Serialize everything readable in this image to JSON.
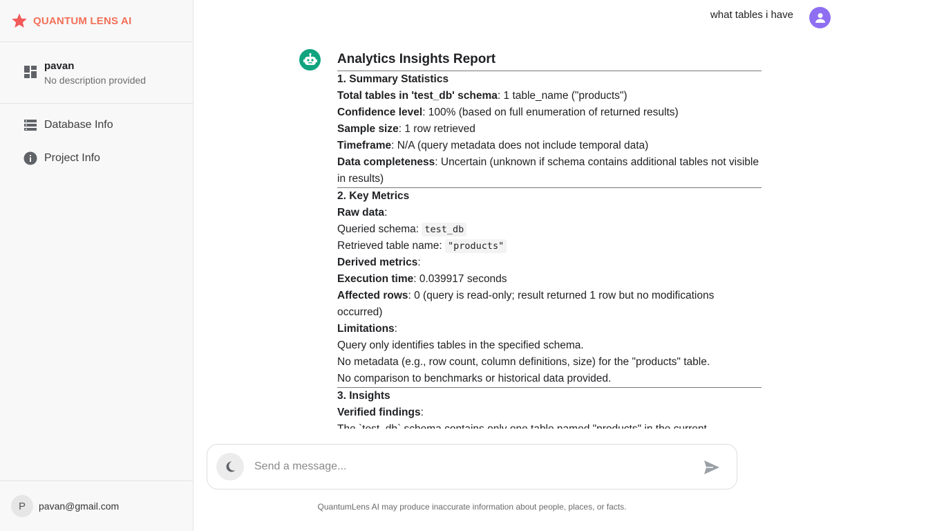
{
  "brand": {
    "name": "QUANTUM LENS AI",
    "color": "#f27058"
  },
  "project": {
    "name": "pavan",
    "description": "No description provided"
  },
  "nav": [
    {
      "label": "Database Info",
      "icon": "database-icon"
    },
    {
      "label": "Project Info",
      "icon": "info-icon"
    }
  ],
  "user": {
    "initial": "P",
    "email": "pavan@gmail.com"
  },
  "chat": {
    "user_message": "what tables i have",
    "report": {
      "title": "Analytics Insights Report",
      "s1": {
        "heading": "1. Summary Statistics",
        "items": [
          {
            "bold": "Total tables in 'test_db' schema",
            "text": ": 1 table_name (\"products\")"
          },
          {
            "bold": "Confidence level",
            "text": ": 100% (based on full enumeration of returned results)"
          },
          {
            "bold": "Sample size",
            "text": ": 1 row retrieved"
          },
          {
            "bold": "Timeframe",
            "text": ": N/A (query metadata does not include temporal data)"
          },
          {
            "bold": "Data completeness",
            "text": ": Uncertain (unknown if schema contains additional tables not visible in results)"
          }
        ]
      },
      "s2": {
        "heading": "2. Key Metrics",
        "raw_label": "Raw data",
        "raw_colon": ":",
        "queried_schema_label": "Queried schema: ",
        "queried_schema_value": "test_db",
        "retrieved_label": "Retrieved table name: ",
        "retrieved_value": "\"products\"",
        "derived_label": "Derived metrics",
        "derived_colon": ":",
        "exec_bold": "Execution time",
        "exec_text": ": 0.039917 seconds",
        "affected_bold": "Affected rows",
        "affected_text": ": 0 (query is read-only; result returned 1 row but no modifications occurred)",
        "limitations_label": "Limitations",
        "limitations_colon": ":",
        "lim1": "Query only identifies tables in the specified schema.",
        "lim2": "No metadata (e.g., row count, column definitions, size) for the \"products\" table.",
        "lim3": "No comparison to benchmarks or historical data provided."
      },
      "s3": {
        "heading": "3. Insights",
        "verified_label": "Verified findings",
        "verified_colon": ":",
        "partial_line": "The `test_db` schema contains only one table named \"products\" in the current"
      }
    }
  },
  "composer": {
    "placeholder": "Send a message..."
  },
  "disclaimer": "QuantumLens AI may produce inaccurate information about people, places, or facts."
}
